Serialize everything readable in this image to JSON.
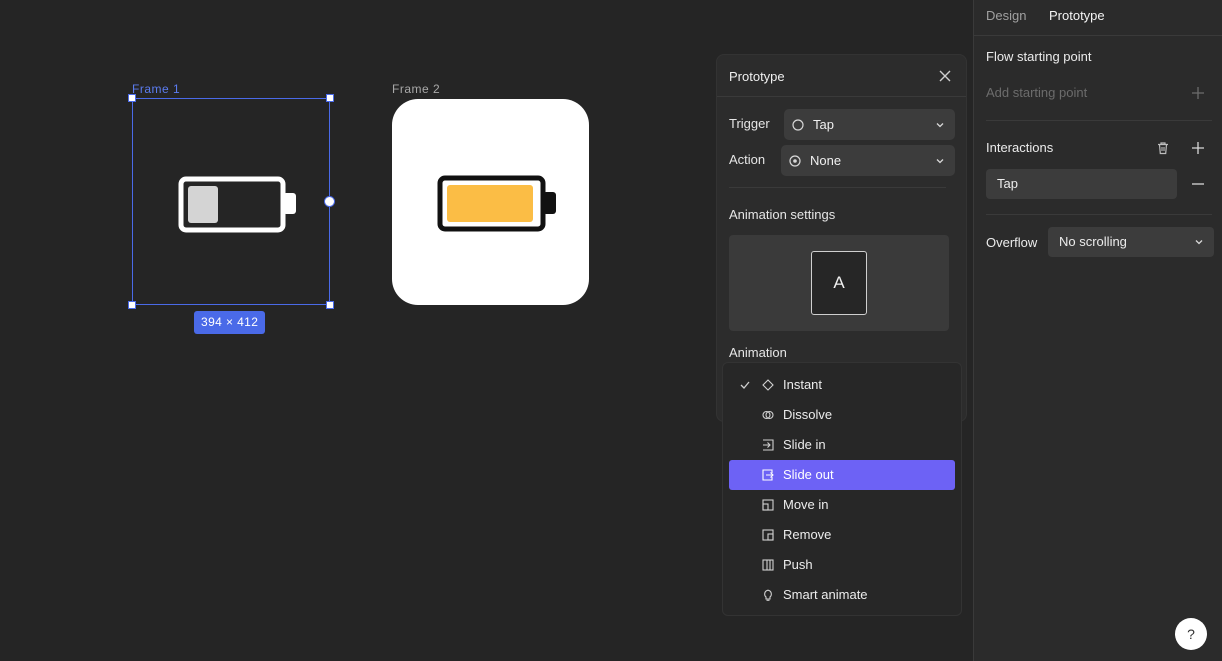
{
  "canvas": {
    "frame1": {
      "label": "Frame 1",
      "dimensions": "394 × 412",
      "battery_fill_color": "#d4d4d4"
    },
    "frame2": {
      "label": "Frame 2",
      "battery_fill_color": "#fbbd45"
    }
  },
  "prototype_panel": {
    "title": "Prototype",
    "trigger": {
      "label": "Trigger",
      "value": "Tap",
      "icon": "circle-icon"
    },
    "action": {
      "label": "Action",
      "value": "None",
      "icon": "radio-dot-icon"
    },
    "animation_settings_label": "Animation settings",
    "preview_letter": "A",
    "animation_label": "Animation"
  },
  "animation_dropdown": {
    "items": [
      {
        "label": "Instant",
        "icon": "diamond-icon",
        "checked": true
      },
      {
        "label": "Dissolve",
        "icon": "dissolve-icon"
      },
      {
        "label": "Slide in",
        "icon": "slide-in-icon"
      },
      {
        "label": "Slide out",
        "icon": "slide-out-icon",
        "highlighted": true
      },
      {
        "label": "Move in",
        "icon": "move-in-icon"
      },
      {
        "label": "Remove",
        "icon": "remove-icon"
      },
      {
        "label": "Push",
        "icon": "push-icon"
      },
      {
        "label": "Smart animate",
        "icon": "bulb-icon"
      }
    ]
  },
  "sidebar": {
    "tabs": [
      {
        "label": "Design"
      },
      {
        "label": "Prototype",
        "active": true
      }
    ],
    "flow_starting_point": "Flow starting point",
    "add_starting_point": "Add starting point",
    "interactions_label": "Interactions",
    "interaction_item": "Tap",
    "overflow_label": "Overflow",
    "overflow_value": "No scrolling"
  },
  "help_label": "?",
  "colors": {
    "accent": "#6d62f5",
    "selection": "#4a6ae8",
    "bg": "#252525",
    "panel": "#2c2c2c"
  }
}
